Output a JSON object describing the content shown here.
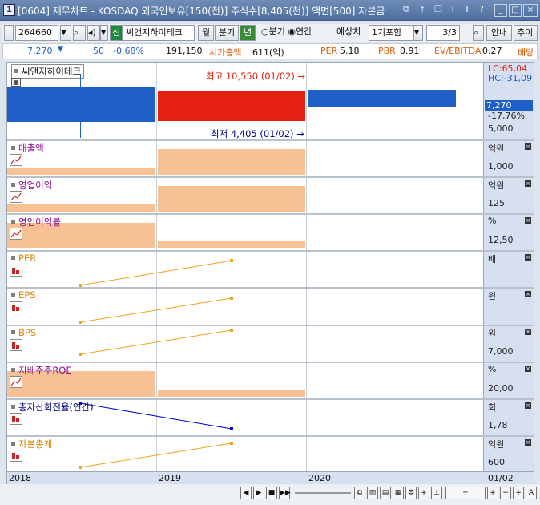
{
  "window": {
    "number": "1",
    "title": "[0604] 재무차트 - KOSDAQ 외국인보유[150(천)] 주식수[8,405(천)] 액면[500] 자본금"
  },
  "toolbar": {
    "code": "264660",
    "market_tag": "신",
    "company": "씨앤지하이테크",
    "tabs": [
      "월",
      "분기",
      "년"
    ],
    "radio_quarter": "분기",
    "radio_annual": "연간",
    "forecast_label": "예상치",
    "forecast_value": "1기포함",
    "page": "3/3",
    "help": "안내",
    "add": "추이"
  },
  "quote": {
    "price": "7,270",
    "change": "50",
    "change_pct": "-0.68%",
    "volume": "191,150",
    "mcap_label": "시가총액",
    "mcap_value": "611(억)",
    "per_label": "PER",
    "per_value": "5.18",
    "pbr_label": "PBR",
    "pbr_value": "0.91",
    "ev_label": "EV/EBITDA",
    "ev_value": "0.27",
    "div_label": "배당"
  },
  "price_panel": {
    "name": "씨앤지하이테크",
    "high_text": "최고 10,550 (01/02)",
    "low_text": "최저 4,405 (01/02)",
    "lc": "LC:65,04",
    "hc": "HC:-31,09",
    "last": "7,270",
    "pct": "-17,76%",
    "tick": "5,000"
  },
  "panels": [
    {
      "name": "매출액",
      "unit": "억원",
      "tick": "1,000",
      "color": "#8b0a8b"
    },
    {
      "name": "영업이익",
      "unit": "억원",
      "tick": "125",
      "color": "#8b0a8b"
    },
    {
      "name": "영업이익률",
      "unit": "%",
      "tick": "12,50",
      "color": "#8b0a8b"
    },
    {
      "name": "PER",
      "unit": "배",
      "tick": "",
      "color": "#d98300"
    },
    {
      "name": "EPS",
      "unit": "원",
      "tick": "",
      "color": "#d98300"
    },
    {
      "name": "BPS",
      "unit": "원",
      "tick": "7,000",
      "color": "#d98300"
    },
    {
      "name": "지배주주ROE",
      "unit": "%",
      "tick": "20,00",
      "color": "#8b0a8b"
    },
    {
      "name": "총자산회전율(연간)",
      "unit": "회",
      "tick": "1,78",
      "color": "#00008b"
    },
    {
      "name": "자본총계",
      "unit": "억원",
      "tick": "600",
      "color": "#d98300"
    }
  ],
  "xaxis": {
    "years": [
      "2018",
      "2019",
      "2020"
    ],
    "last": "01/02"
  },
  "colors": {
    "up": "#e62010",
    "down": "#1e5fc8",
    "fin_bar": "#f8c194",
    "line": "#f0a020",
    "blue_line": "#0000cc"
  }
}
